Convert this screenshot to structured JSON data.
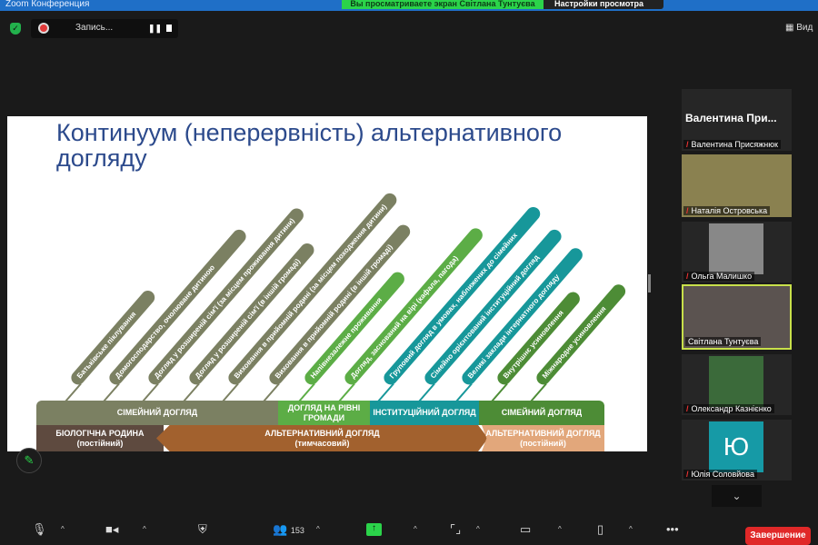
{
  "window": {
    "title": "Zoom Конференция",
    "banner": "Вы просматриваете экран Світлана Тунтуєва",
    "view_settings": "Настройки просмотра",
    "recording": "Запись...",
    "view": "Вид"
  },
  "slide": {
    "title": "Континуум (неперервність) альтернативного догляду",
    "pills": [
      {
        "label": "Батьківське піклування",
        "color": "#7b8062",
        "len": 132
      },
      {
        "label": "Домогосподарство, очолюване дитиною",
        "color": "#7b8062",
        "len": 221
      },
      {
        "label": "Догляд у розширеній сім'ї (за місцем проживання дитини)",
        "color": "#7b8062",
        "len": 252
      },
      {
        "label": "Догляд у розширеній сім'ї (в іншій громаді)",
        "color": "#7b8062",
        "len": 201
      },
      {
        "label": "Виховання в прийомній родині (за місцем походження дитини)",
        "color": "#7b8062",
        "len": 274
      },
      {
        "label": "Виховання в прийомній родині (в іншій громаді)",
        "color": "#7b8062",
        "len": 228
      },
      {
        "label": "Напівнезалежне проживання",
        "color": "#5cad46",
        "len": 159
      },
      {
        "label": "Догляд, заснований на вірі (кафала, пагода)",
        "color": "#5cad46",
        "len": 223
      },
      {
        "label": "Груповий догляд в умовах, наближених до сімейних",
        "color": "#17979a",
        "len": 254
      },
      {
        "label": "Сімейно орієнтований інституційний догляд",
        "color": "#17979a",
        "len": 221
      },
      {
        "label": "Великі заклади інтернатного догляду",
        "color": "#17979a",
        "len": 194
      },
      {
        "label": "Внутрішнє усиновлення",
        "color": "#4d8c36",
        "len": 130
      },
      {
        "label": "Міжнародне усиновлення",
        "color": "#4d8c36",
        "len": 141
      }
    ],
    "bar_top": [
      {
        "label": "СІМЕЙНИЙ ДОГЛЯД"
      },
      {
        "label": "ДОГЛЯД НА РІВНІ ГРОМАДИ"
      },
      {
        "label": "ІНСТИТУЦІЙНИЙ ДОГЛЯД"
      },
      {
        "label": "СІМЕЙНИЙ ДОГЛЯД"
      }
    ],
    "bar_bottom": [
      {
        "label": "БІОЛОГІЧНА РОДИНА",
        "sub": "(постійний)"
      },
      {
        "label": "АЛЬТЕРНАТИВНИЙ ДОГЛЯД",
        "sub": "(тимчасовий)"
      },
      {
        "label": "АЛЬТЕРНАТИВНИЙ ДОГЛЯД",
        "sub": "(постійний)"
      }
    ]
  },
  "participants": {
    "big_name": "Валентина При...",
    "list": [
      "Валентина Присяжнюк",
      "Наталія Островська",
      "Ольга Малишко",
      "Світлана Тунтуєва",
      "Олександр Казнієнко",
      "Юлія Соловйова"
    ],
    "avatar_letter": "Ю"
  },
  "toolbar": {
    "participants_count": "153",
    "end": "Завершение"
  }
}
